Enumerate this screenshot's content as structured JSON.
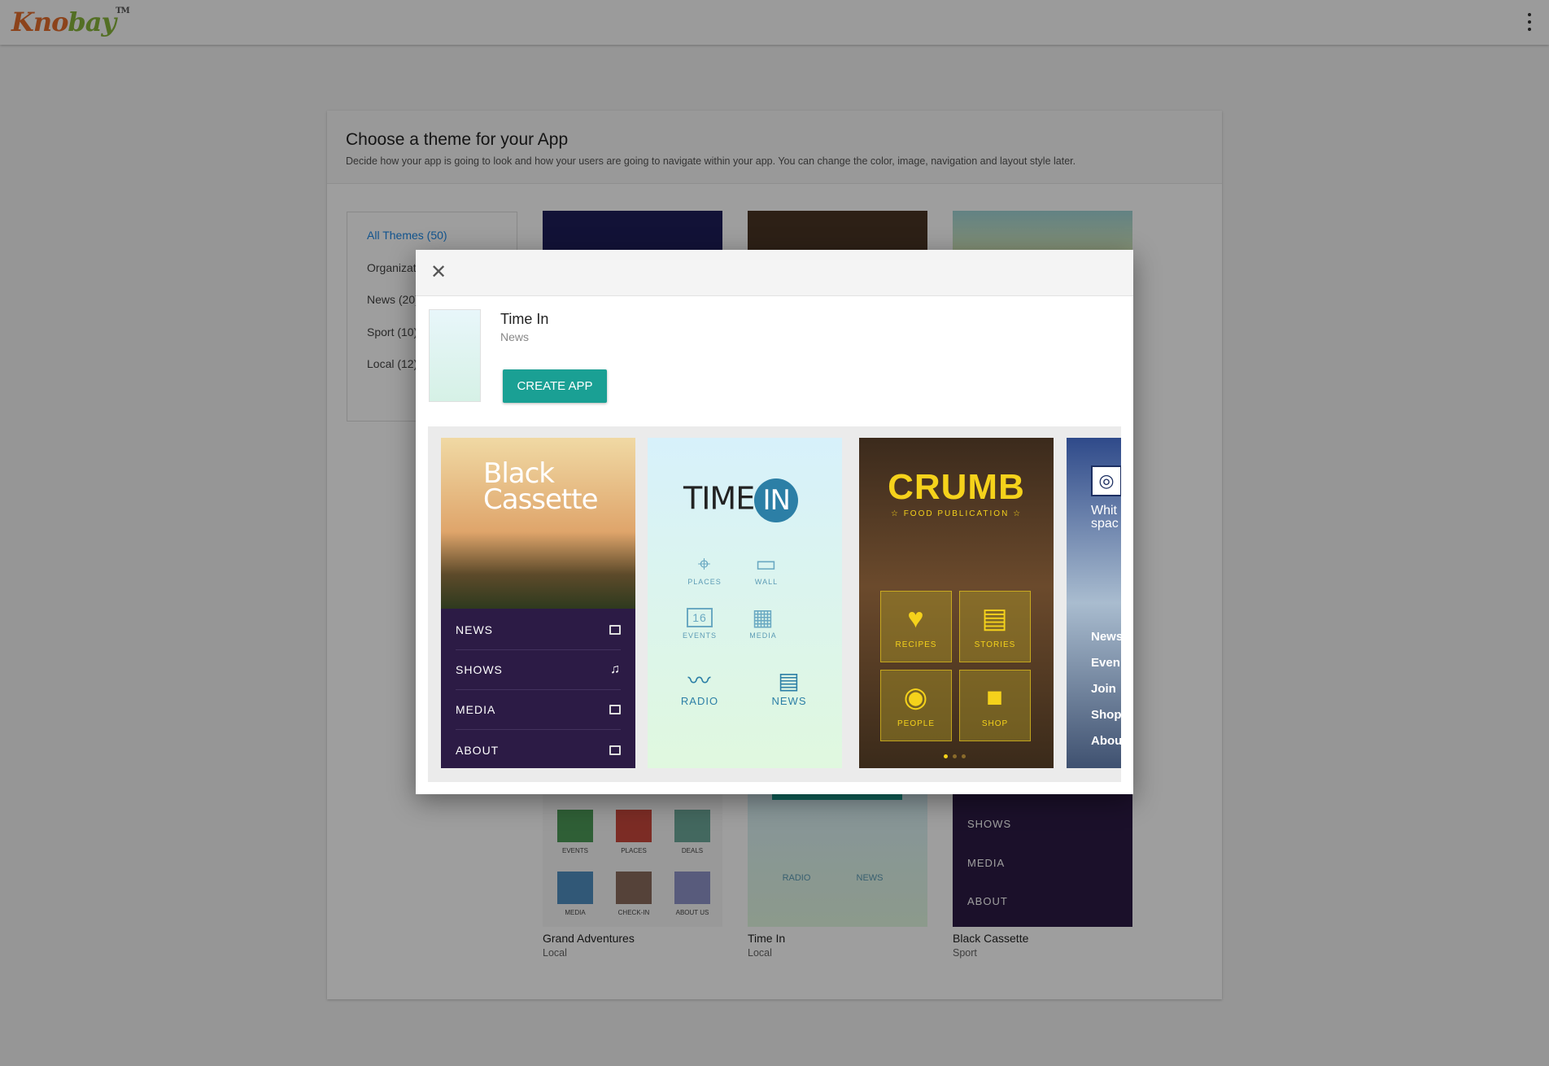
{
  "app": {
    "logo_part1": "Kno",
    "logo_part2": "bay",
    "logo_tm": "TM"
  },
  "card": {
    "title": "Choose a theme for your App",
    "subtitle": "Decide how your app is going to look and how your users are going to navigate within your app. You can change the color, image, navigation and layout style later."
  },
  "categories": [
    {
      "label": "All Themes (50)",
      "active": true
    },
    {
      "label": "Organizat"
    },
    {
      "label": "News (20)"
    },
    {
      "label": "Sport (10)"
    },
    {
      "label": "Local (12)"
    }
  ],
  "tiles": [
    {
      "name": "Grand Adventures",
      "category": "Local",
      "labels": [
        "EVENTS",
        "PLACES",
        "DEALS",
        "MEDIA",
        "CHECK-IN",
        "ABOUT US"
      ]
    },
    {
      "name": "Time In",
      "category": "Local",
      "labels": [
        "RADIO",
        "NEWS"
      ]
    },
    {
      "name": "Black Cassette",
      "category": "Sport",
      "labels": [
        "SHOWS",
        "MEDIA",
        "ABOUT"
      ]
    }
  ],
  "modal": {
    "title": "Time In",
    "category": "News",
    "create_label": "CREATE APP",
    "close_glyph": "✕"
  },
  "screens": {
    "black_cassette": {
      "brand_line1": "Black",
      "brand_line2": "Cassette",
      "menu": [
        "NEWS",
        "SHOWS",
        "MEDIA",
        "ABOUT"
      ]
    },
    "time_in": {
      "logo_text": "TIME",
      "logo_in": "IN",
      "cells": [
        "PLACES",
        "WALL",
        "EVENTS",
        "MEDIA",
        "RADIO",
        "NEWS"
      ],
      "calendar_day": "16"
    },
    "crumb": {
      "title": "CRUMB",
      "subtitle": "☆ FOOD PUBLICATION ☆",
      "boxes": [
        "RECIPES",
        "STORIES",
        "PEOPLE",
        "SHOP"
      ]
    },
    "white_space": {
      "title_line1": "Whit",
      "title_line2": "spac",
      "items": [
        "News",
        "Even",
        "Join",
        "Shop",
        "Abou"
      ]
    }
  },
  "colors": {
    "accent": "#1aa094",
    "link": "#1e88e5",
    "cassette_bg": "#2c1b45",
    "crumb_yellow": "#f5d21b",
    "timein_blue": "#2c7fa6"
  }
}
